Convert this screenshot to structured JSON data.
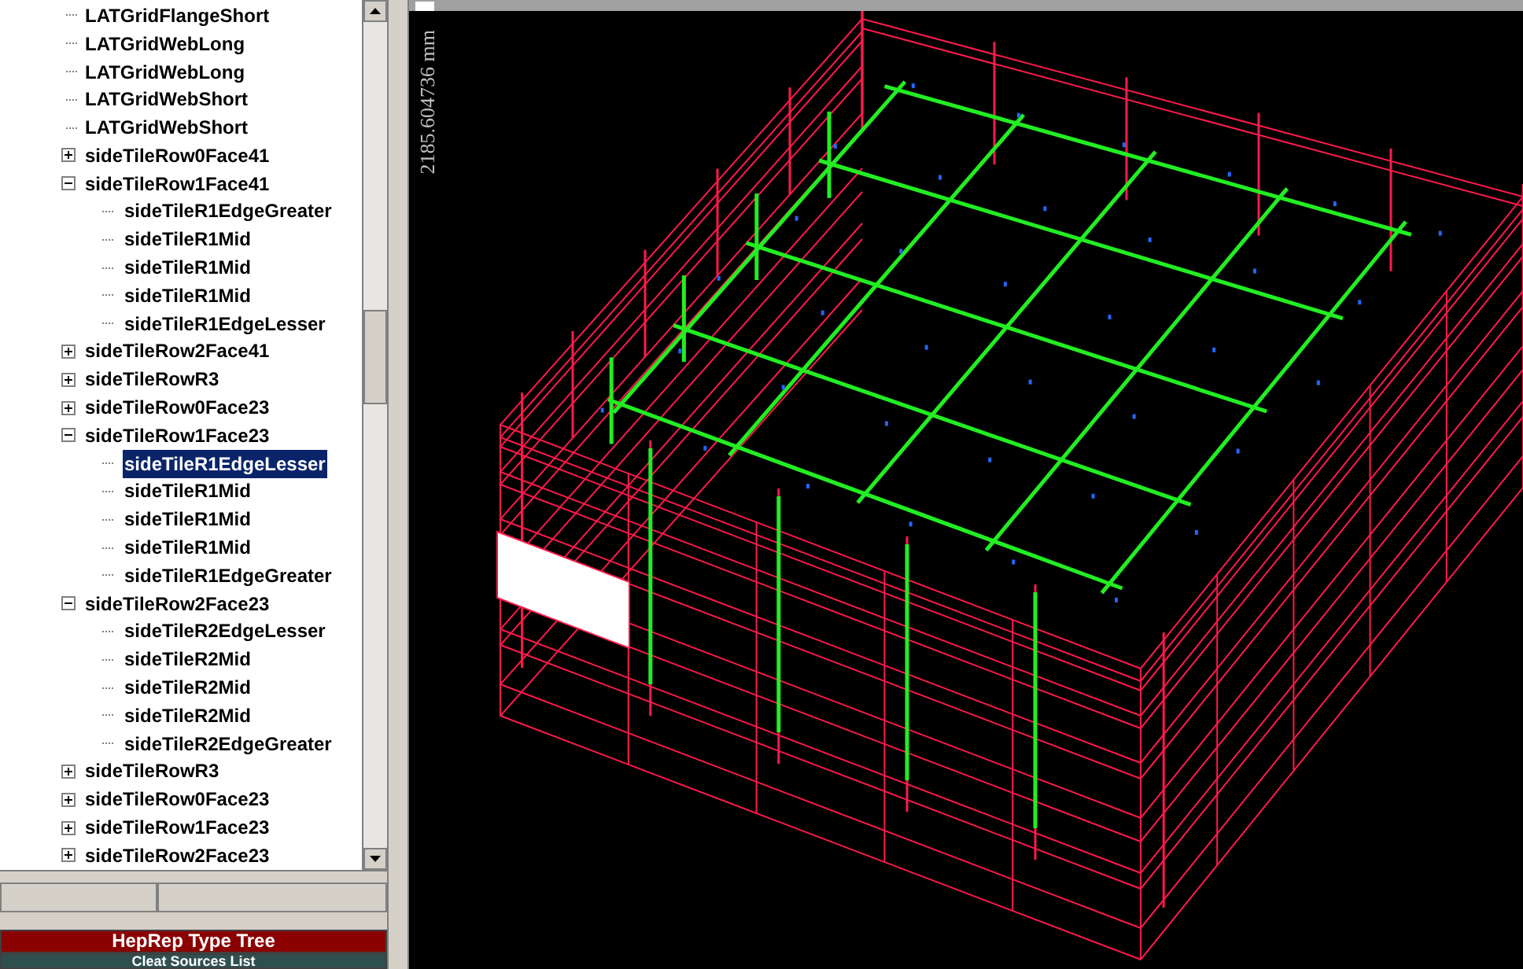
{
  "tree": {
    "items": [
      {
        "label": "LATGridFlangeShort",
        "selected": false
      },
      {
        "label": "LATGridWebLong",
        "selected": false
      },
      {
        "label": "LATGridWebLong",
        "selected": false
      },
      {
        "label": "LATGridWebShort",
        "selected": false
      },
      {
        "label": "LATGridWebShort",
        "selected": false
      },
      {
        "label": "sideTileRow0Face41",
        "expanded": false,
        "selected": false
      },
      {
        "label": "sideTileRow1Face41",
        "expanded": true,
        "selected": false,
        "children": [
          {
            "label": "sideTileR1EdgeGreater",
            "selected": false
          },
          {
            "label": "sideTileR1Mid",
            "selected": false
          },
          {
            "label": "sideTileR1Mid",
            "selected": false
          },
          {
            "label": "sideTileR1Mid",
            "selected": false
          },
          {
            "label": "sideTileR1EdgeLesser",
            "selected": false
          }
        ]
      },
      {
        "label": "sideTileRow2Face41",
        "expanded": false,
        "selected": false
      },
      {
        "label": "sideTileRowR3",
        "expanded": false,
        "selected": false
      },
      {
        "label": "sideTileRow0Face23",
        "expanded": false,
        "selected": false
      },
      {
        "label": "sideTileRow1Face23",
        "expanded": true,
        "selected": false,
        "children": [
          {
            "label": "sideTileR1EdgeLesser",
            "selected": true
          },
          {
            "label": "sideTileR1Mid",
            "selected": false
          },
          {
            "label": "sideTileR1Mid",
            "selected": false
          },
          {
            "label": "sideTileR1Mid",
            "selected": false
          },
          {
            "label": "sideTileR1EdgeGreater",
            "selected": false
          }
        ]
      },
      {
        "label": "sideTileRow2Face23",
        "expanded": true,
        "selected": false,
        "children": [
          {
            "label": "sideTileR2EdgeLesser",
            "selected": false
          },
          {
            "label": "sideTileR2Mid",
            "selected": false
          },
          {
            "label": "sideTileR2Mid",
            "selected": false
          },
          {
            "label": "sideTileR2Mid",
            "selected": false
          },
          {
            "label": "sideTileR2EdgeGreater",
            "selected": false
          }
        ]
      },
      {
        "label": "sideTileRowR3",
        "expanded": false,
        "selected": false
      },
      {
        "label": "sideTileRow0Face23",
        "expanded": false,
        "selected": false
      },
      {
        "label": "sideTileRow1Face23",
        "expanded": false,
        "selected": false
      },
      {
        "label": "sideTileRow2Face23",
        "expanded": false,
        "selected": false
      }
    ]
  },
  "panel_tabs": [
    {
      "label": "HepRep Type Tree",
      "selected": true
    },
    {
      "label": "Cleat Sources List",
      "selected": false
    }
  ],
  "viewer": {
    "scale_label": "2185.604736 mm"
  }
}
